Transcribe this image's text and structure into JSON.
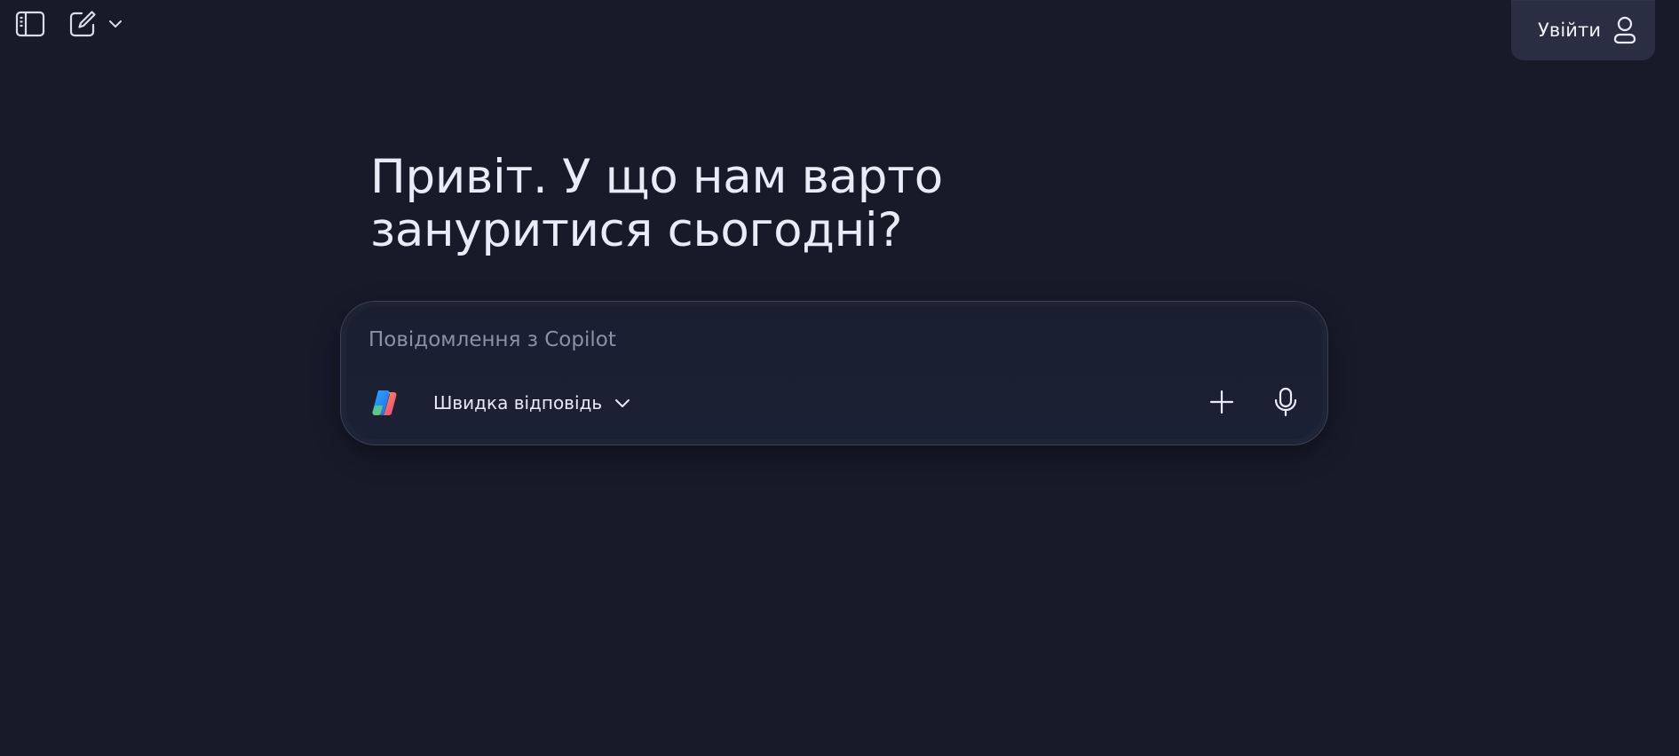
{
  "toolbar": {
    "sidebar_icon": "sidebar-panel-icon",
    "new_chat_icon": "compose-icon",
    "dropdown_icon": "chevron-down-icon"
  },
  "header": {
    "signin_label": "Увійти",
    "signin_icon": "user-icon"
  },
  "main": {
    "greeting": "Привіт. У що нам варто зануритися сьогодні?"
  },
  "composer": {
    "placeholder": "Повідомлення з Copilot",
    "value": "",
    "mode_label": "Швидка відповідь",
    "logo_icon": "copilot-logo-icon",
    "plus_icon": "plus-icon",
    "mic_icon": "microphone-icon"
  },
  "colors": {
    "background": "#171a29",
    "signin_background": "#292e42",
    "composer_border": "#3a4056",
    "text": "#e8ebf5",
    "placeholder": "#8b91a6"
  }
}
